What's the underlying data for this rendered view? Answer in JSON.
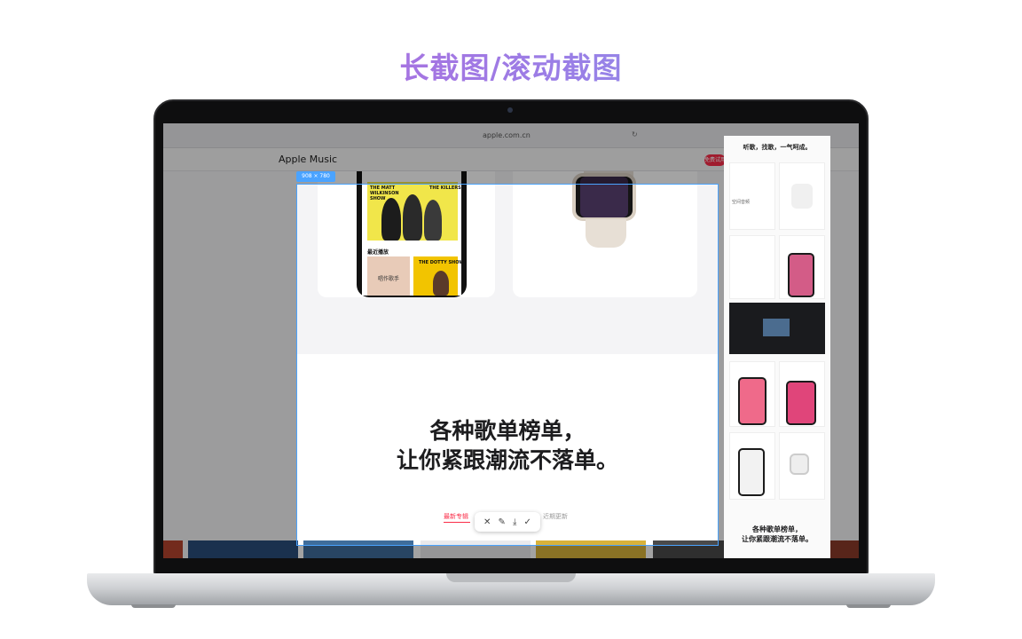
{
  "heading": "长截图/滚动截图",
  "browser": {
    "url": "apple.com.cn"
  },
  "site": {
    "title": "Apple Music",
    "try_button": "免费试用"
  },
  "selection": {
    "size_label": "908 × 780"
  },
  "phone": {
    "album_left": "THE MATT WILKINSON SHOW",
    "album_right": "THE KILLERS",
    "recent_label": "最近播放",
    "thumb1_text": "唱作歌手",
    "thumb2_text": "THE DOTTY SHOW"
  },
  "main": {
    "headline_line1": "各种歌单榜单，",
    "headline_line2": "让你紧跟潮流不落单。",
    "tab_active": "最新专辑",
    "tab_right": "近期更新"
  },
  "toolbar": {
    "cancel_icon": "✕",
    "pen_icon": "✎",
    "save_icon": "⤓",
    "done_icon": "✓"
  },
  "preview": {
    "title": "听歌，找歌，一气呵成。",
    "mini_label": "空间音频",
    "headline_line1": "各种歌单榜单，",
    "headline_line2": "让你紧跟潮流不落单。"
  },
  "colors": {
    "accent": "#fa2d48",
    "selection": "#4aa3ff"
  }
}
